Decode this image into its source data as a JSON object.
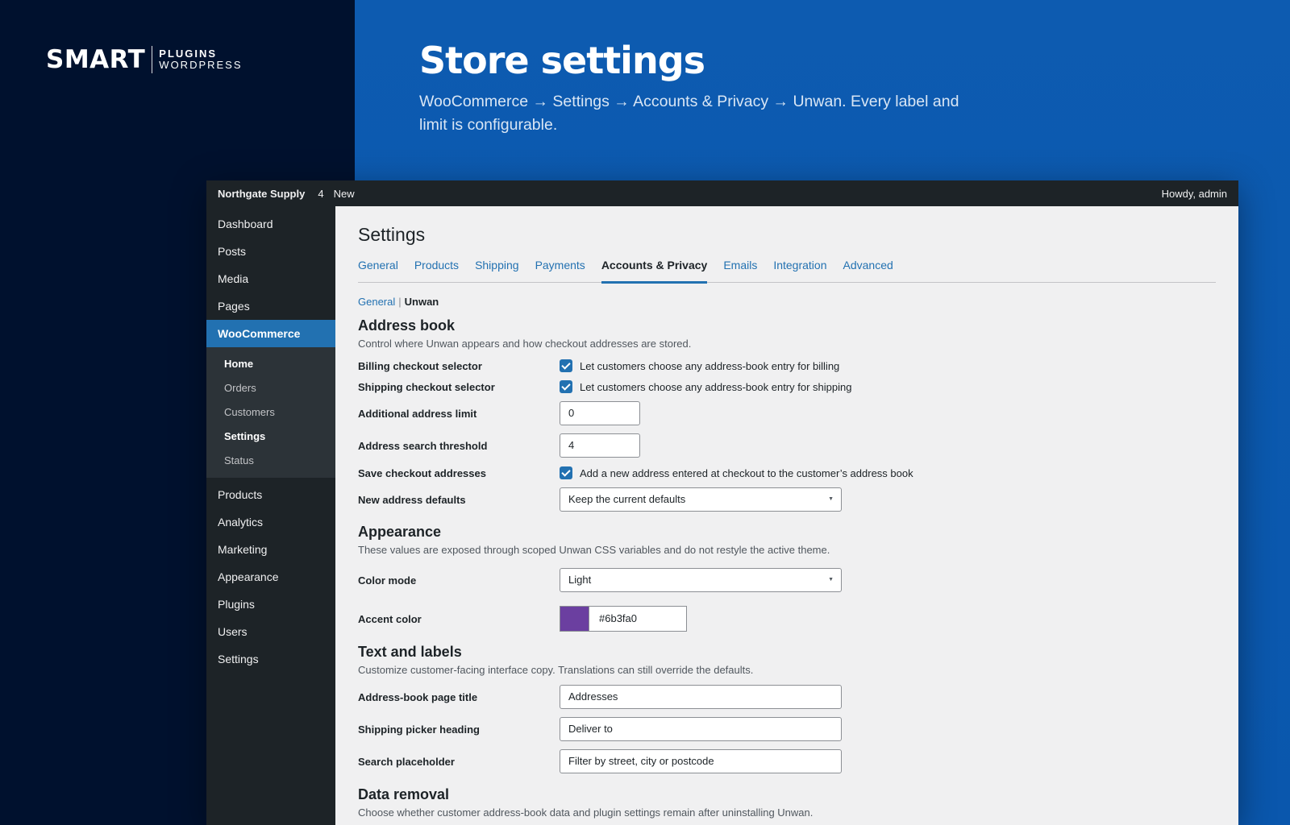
{
  "brand": {
    "main": "SMART",
    "sub_top": "PLUGINS",
    "sub_bottom": "WORDPRESS"
  },
  "hero": {
    "title": "Store settings",
    "subtitle": "WooCommerce → Settings → Accounts & Privacy → Unwan. Every label and limit is configurable."
  },
  "adminbar": {
    "site": "Northgate Supply",
    "count": "4",
    "new": "New",
    "howdy": "Howdy, admin"
  },
  "sidebar": {
    "top_items": [
      "Dashboard",
      "Posts",
      "Media",
      "Pages"
    ],
    "active": "WooCommerce",
    "submenu": [
      "Home",
      "Orders",
      "Customers",
      "Settings",
      "Status"
    ],
    "bottom_items": [
      "Products",
      "Analytics",
      "Marketing",
      "Appearance",
      "Plugins",
      "Users",
      "Settings"
    ]
  },
  "page": {
    "title": "Settings",
    "tabs": [
      "General",
      "Products",
      "Shipping",
      "Payments",
      "Accounts & Privacy",
      "Emails",
      "Integration",
      "Advanced"
    ],
    "active_tab": "Accounts & Privacy",
    "subnav": {
      "link": "General",
      "current": "Unwan"
    }
  },
  "address_book": {
    "title": "Address book",
    "desc": "Control where Unwan appears and how checkout addresses are stored.",
    "billing_label": "Billing checkout selector",
    "billing_text": "Let customers choose any address-book entry for billing",
    "shipping_label": "Shipping checkout selector",
    "shipping_text": "Let customers choose any address-book entry for shipping",
    "limit_label": "Additional address limit",
    "limit_value": "0",
    "threshold_label": "Address search threshold",
    "threshold_value": "4",
    "save_label": "Save checkout addresses",
    "save_text": "Add a new address entered at checkout to the customer’s address book",
    "defaults_label": "New address defaults",
    "defaults_value": "Keep the current defaults"
  },
  "appearance": {
    "title": "Appearance",
    "desc": "These values are exposed through scoped Unwan CSS variables and do not restyle the active theme.",
    "mode_label": "Color mode",
    "mode_value": "Light",
    "accent_label": "Accent color",
    "accent_value": "#6b3fa0"
  },
  "labels": {
    "title": "Text and labels",
    "desc": "Customize customer-facing interface copy. Translations can still override the defaults.",
    "page_title_label": "Address-book page title",
    "page_title_value": "Addresses",
    "picker_label": "Shipping picker heading",
    "picker_value": "Deliver to",
    "placeholder_label": "Search placeholder",
    "placeholder_value": "Filter by street, city or postcode"
  },
  "data_removal": {
    "title": "Data removal",
    "desc": "Choose whether customer address-book data and plugin settings remain after uninstalling Unwan."
  },
  "colors": {
    "accent": "#6b3fa0",
    "wp_blue": "#2271b1",
    "hero_bg": "#0d5bb0",
    "dark_bg": "#00112e"
  }
}
